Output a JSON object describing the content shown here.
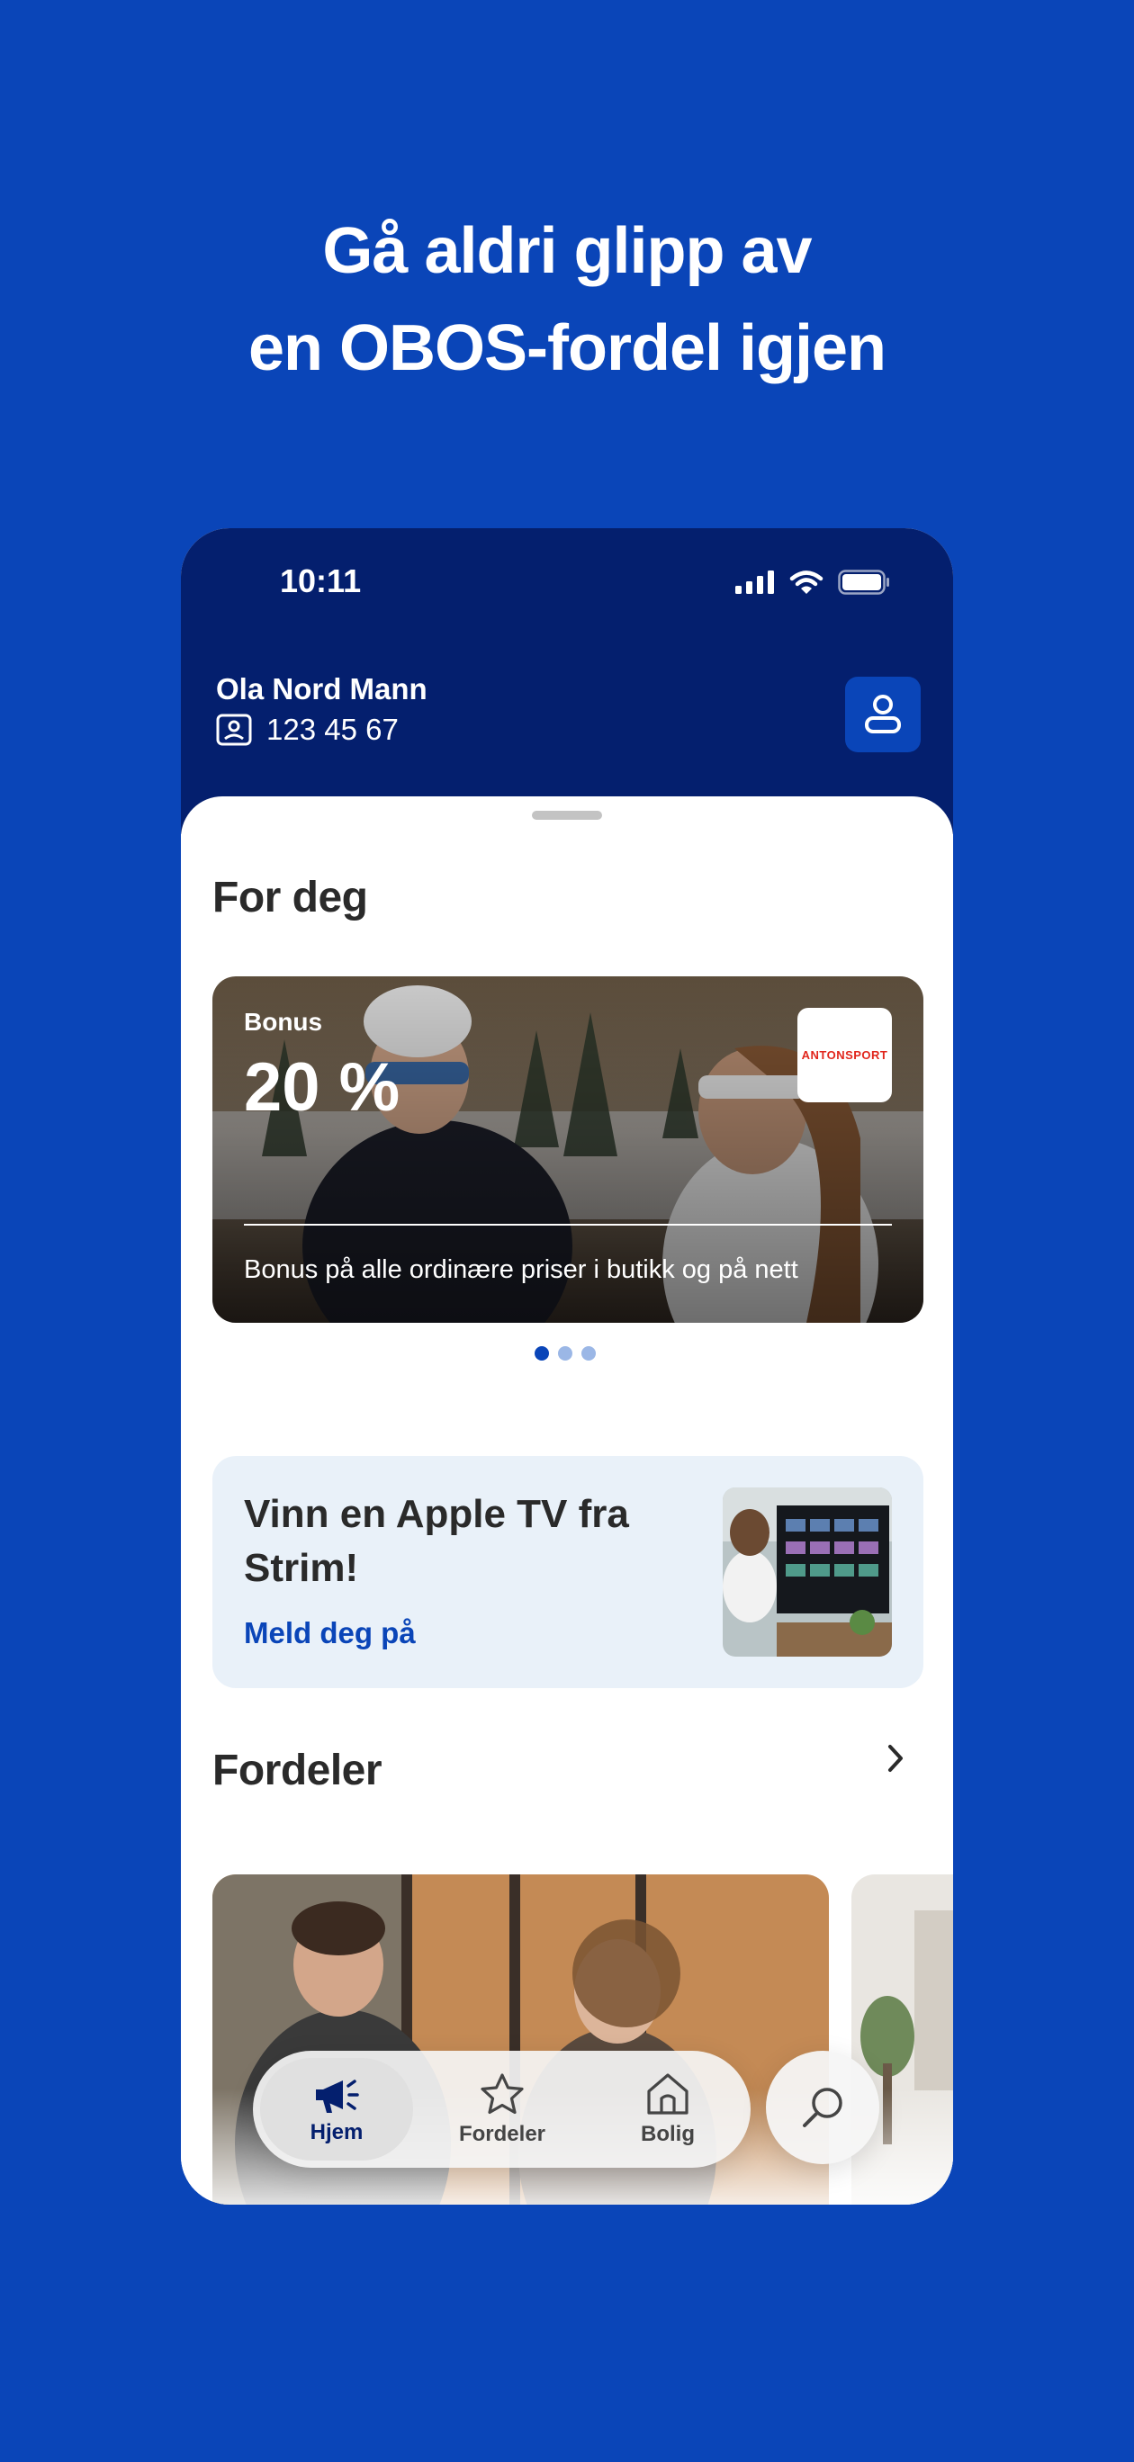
{
  "headline": {
    "line1": "Gå aldri glipp av",
    "line2": "en OBOS-fordel igjen"
  },
  "status_bar": {
    "time": "10:11",
    "icons": [
      "cellular-signal-icon",
      "wifi-icon",
      "battery-icon"
    ]
  },
  "header": {
    "user_name": "Ola Nord Mann",
    "member_number": "123 45 67",
    "profile_icon": "user-icon"
  },
  "for_deg": {
    "title": "For deg",
    "bonus_card": {
      "label": "Bonus",
      "value": "20 %",
      "description": "Bonus på alle ordinære priser i butikk og på nett",
      "brand_logo_text": "ANTONSPORT"
    },
    "carousel": {
      "count": 3,
      "active_index": 0
    }
  },
  "promo": {
    "title": "Vinn en Apple TV fra Strim!",
    "link": "Meld deg på"
  },
  "fordeler": {
    "title": "Fordeler"
  },
  "tab_bar": {
    "tabs": [
      {
        "label": "Hjem",
        "icon": "megaphone-icon",
        "active": true
      },
      {
        "label": "Fordeler",
        "icon": "star-icon",
        "active": false
      },
      {
        "label": "Bolig",
        "icon": "house-icon",
        "active": false
      }
    ],
    "search_icon": "search-icon"
  },
  "colors": {
    "background": "#0a45b8",
    "header": "#041f6e",
    "accent": "#0a45b8",
    "promo_bg": "#e9f1f9",
    "text": "#2a2a2a"
  }
}
